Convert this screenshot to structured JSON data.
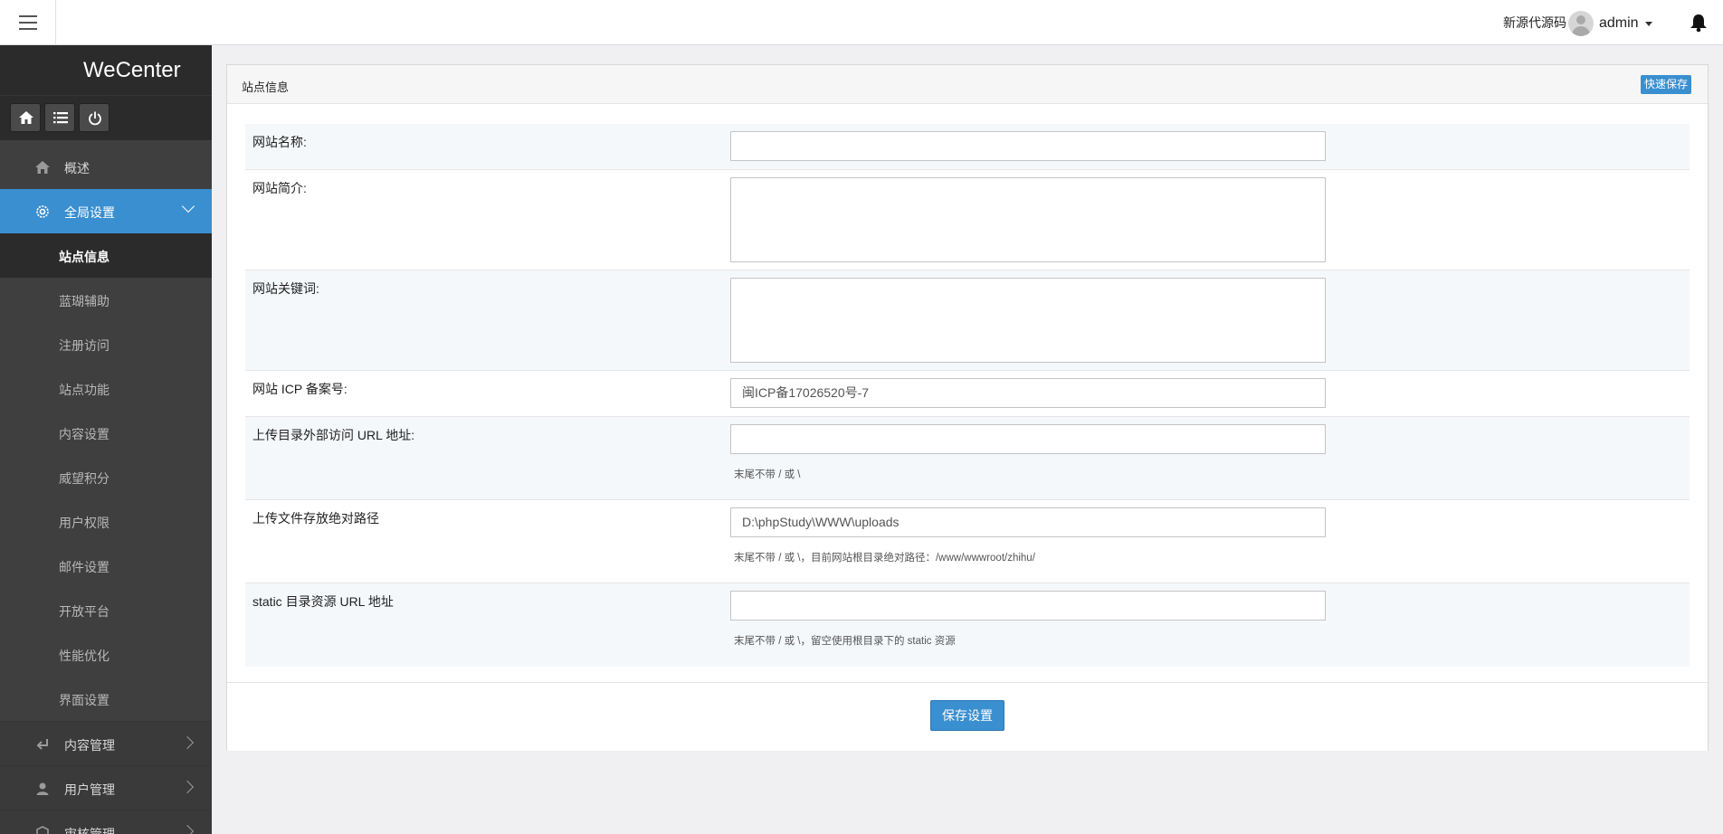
{
  "topbar": {
    "source_link": "新源代源码",
    "username": "admin"
  },
  "sidebar": {
    "brand": "WeCenter",
    "nav": [
      {
        "label": "概述",
        "icon": "home-icon"
      },
      {
        "label": "全局设置",
        "icon": "gear-icon",
        "active": true,
        "children": [
          "站点信息",
          "蓝瑚辅助",
          "注册访问",
          "站点功能",
          "内容设置",
          "威望积分",
          "用户权限",
          "邮件设置",
          "开放平台",
          "性能优化",
          "界面设置"
        ]
      },
      {
        "label": "内容管理",
        "icon": "return-icon"
      },
      {
        "label": "用户管理",
        "icon": "user-icon"
      },
      {
        "label": "审核管理",
        "icon": "review-icon"
      }
    ],
    "current_child": "站点信息"
  },
  "panel": {
    "title": "站点信息",
    "quick_save": "快速保存",
    "save_button": "保存设置"
  },
  "form": {
    "site_name": {
      "label": "网站名称:",
      "value": ""
    },
    "site_intro": {
      "label": "网站简介:",
      "value": ""
    },
    "site_keywords": {
      "label": "网站关键词:",
      "value": ""
    },
    "icp": {
      "label": "网站 ICP 备案号:",
      "value": "闽ICP备17026520号-7"
    },
    "upload_url": {
      "label": "上传目录外部访问 URL 地址:",
      "value": "",
      "hint": "末尾不带 / 或 \\"
    },
    "upload_path": {
      "label": "上传文件存放绝对路径",
      "value": "D:\\phpStudy\\WWW\\uploads",
      "hint": "末尾不带 / 或 \\，目前网站根目录绝对路径：/www/wwwroot/zhihu/"
    },
    "static_url": {
      "label": "static 目录资源 URL 地址",
      "value": "",
      "hint": "末尾不带 / 或 \\，留空使用根目录下的 static 资源"
    }
  },
  "colors": {
    "accent": "#3a8fd0",
    "sidebar": "#3f3f3f",
    "sidebar_dark": "#2b2b2b"
  }
}
